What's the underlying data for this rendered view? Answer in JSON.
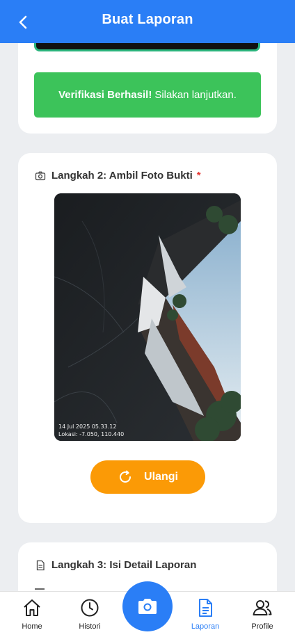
{
  "header": {
    "title": "Buat Laporan"
  },
  "verification": {
    "bold": "Verifikasi Berhasil!",
    "message": "Silakan lanjutkan."
  },
  "step2": {
    "title": "Langkah 2: Ambil Foto Bukti",
    "required_mark": "*",
    "photo_timestamp": "14 Jul 2025 05.33.12",
    "photo_location": "Lokasi: -7.050, 110.440",
    "retake_label": "Ulangi"
  },
  "step3": {
    "title": "Langkah 3: Isi Detail Laporan"
  },
  "nav": {
    "home": "Home",
    "histori": "Histori",
    "laporan": "Laporan",
    "profile": "Profile"
  },
  "colors": {
    "primary": "#2a7ef6",
    "success": "#3cc35a",
    "accent": "#fb9a06",
    "required": "#e53935"
  }
}
